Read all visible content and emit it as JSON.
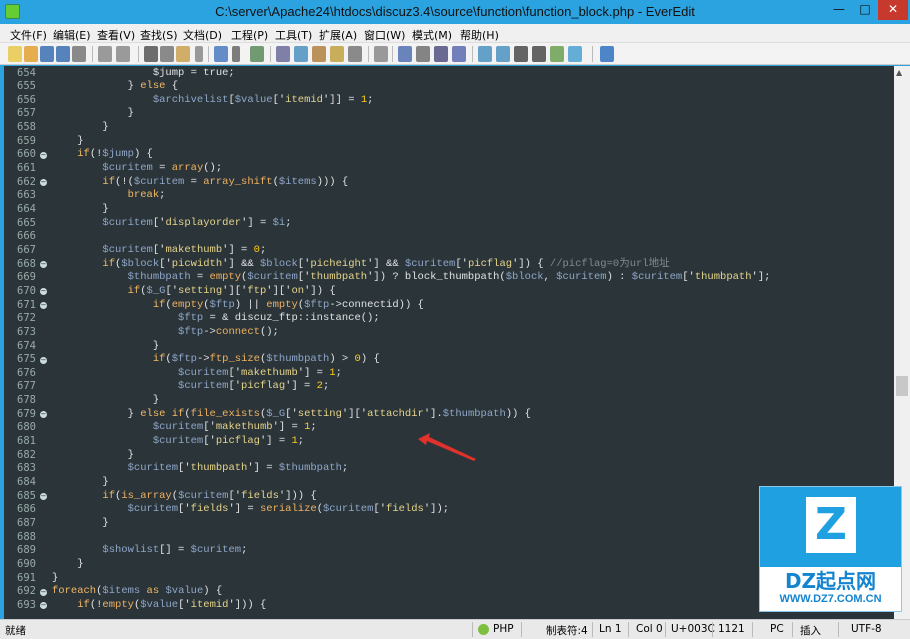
{
  "window": {
    "title": "C:\\server\\Apache24\\htdocs\\discuz3.4\\source\\function\\function_block.php - EverEdit",
    "minimize": "—",
    "maximize": "□",
    "close": "✕"
  },
  "menu": [
    "文件(F)",
    "编辑(E)",
    "查看(V)",
    "查找(S)",
    "文档(D)",
    "工程(P)",
    "工具(T)",
    "扩展(A)",
    "窗口(W)",
    "模式(M)",
    "帮助(H)"
  ],
  "toolbar_icons": [
    "new-file-icon",
    "open-file-icon",
    "save-icon",
    "save-all-icon",
    "print-icon",
    "undo-icon",
    "redo-icon",
    "cut-icon",
    "copy-icon",
    "paste-icon",
    "paste-dropdown-icon",
    "wrap-icon",
    "wrap-dropdown-icon",
    "outline-icon",
    "find-icon",
    "replace-icon",
    "find-in-files-icon",
    "goto-icon",
    "bookmark-icon",
    "column-mode-icon",
    "run-icon",
    "macro-icon",
    "macro-run-icon",
    "macro-record-icon",
    "panel-icon",
    "split-icon",
    "layout-icon",
    "window-icon",
    "browser-icon",
    "refresh-icon",
    "help-icon"
  ],
  "lines": [
    {
      "n": "654",
      "fold": false,
      "tokens": [
        [
          "i",
          "                $jump = true;"
        ]
      ]
    },
    {
      "n": "655",
      "fold": false,
      "tokens": [
        [
          "p",
          "            } "
        ],
        [
          "k",
          "else"
        ],
        [
          "p",
          " {"
        ]
      ]
    },
    {
      "n": "656",
      "fold": false,
      "tokens": [
        [
          "v",
          "                $archivelist"
        ],
        [
          "p",
          "["
        ],
        [
          "v",
          "$value"
        ],
        [
          "p",
          "['"
        ],
        [
          "s",
          "itemid"
        ],
        [
          "p",
          "'"
        ],
        [
          "p",
          "]] = "
        ],
        [
          "n",
          "1"
        ],
        [
          "p",
          ";"
        ]
      ]
    },
    {
      "n": "657",
      "fold": false,
      "tokens": [
        [
          "p",
          "            }"
        ]
      ]
    },
    {
      "n": "658",
      "fold": false,
      "tokens": [
        [
          "p",
          "        }"
        ]
      ]
    },
    {
      "n": "659",
      "fold": false,
      "tokens": [
        [
          "p",
          "    }"
        ]
      ]
    },
    {
      "n": "660",
      "fold": true,
      "tokens": [
        [
          "k",
          "    if"
        ],
        [
          "p",
          "(!"
        ],
        [
          "v",
          "$jump"
        ],
        [
          "p",
          ") {"
        ]
      ]
    },
    {
      "n": "661",
      "fold": false,
      "tokens": [
        [
          "v",
          "        $curitem"
        ],
        [
          "p",
          " = "
        ],
        [
          "f",
          "array"
        ],
        [
          "p",
          "();"
        ]
      ]
    },
    {
      "n": "662",
      "fold": true,
      "tokens": [
        [
          "k",
          "        if"
        ],
        [
          "p",
          "(!("
        ],
        [
          "v",
          "$curitem"
        ],
        [
          "p",
          " = "
        ],
        [
          "f",
          "array_shift"
        ],
        [
          "p",
          "("
        ],
        [
          "v",
          "$items"
        ],
        [
          "p",
          "))) {"
        ]
      ]
    },
    {
      "n": "663",
      "fold": false,
      "tokens": [
        [
          "k",
          "            break"
        ],
        [
          "p",
          ";"
        ]
      ]
    },
    {
      "n": "664",
      "fold": false,
      "tokens": [
        [
          "p",
          "        }"
        ]
      ]
    },
    {
      "n": "665",
      "fold": false,
      "tokens": [
        [
          "v",
          "        $curitem"
        ],
        [
          "p",
          "['"
        ],
        [
          "s",
          "displayorder"
        ],
        [
          "p",
          "'] = "
        ],
        [
          "v",
          "$i"
        ],
        [
          "p",
          ";"
        ]
      ]
    },
    {
      "n": "666",
      "fold": false,
      "tokens": []
    },
    {
      "n": "667",
      "fold": false,
      "tokens": [
        [
          "v",
          "        $curitem"
        ],
        [
          "p",
          "['"
        ],
        [
          "s",
          "makethumb"
        ],
        [
          "p",
          "'] = "
        ],
        [
          "n",
          "0"
        ],
        [
          "p",
          ";"
        ]
      ]
    },
    {
      "n": "668",
      "fold": true,
      "tokens": [
        [
          "k",
          "        if"
        ],
        [
          "p",
          "("
        ],
        [
          "v",
          "$block"
        ],
        [
          "p",
          "['"
        ],
        [
          "s",
          "picwidth"
        ],
        [
          "p",
          "'] && "
        ],
        [
          "v",
          "$block"
        ],
        [
          "p",
          "['"
        ],
        [
          "s",
          "picheight"
        ],
        [
          "p",
          "'] && "
        ],
        [
          "v",
          "$curitem"
        ],
        [
          "p",
          "['"
        ],
        [
          "s",
          "picflag"
        ],
        [
          "p",
          "']) { "
        ],
        [
          "c",
          "//picflag=0为url地址"
        ]
      ]
    },
    {
      "n": "669",
      "fold": false,
      "tokens": [
        [
          "v",
          "            $thumbpath"
        ],
        [
          "p",
          " = "
        ],
        [
          "f",
          "empty"
        ],
        [
          "p",
          "("
        ],
        [
          "v",
          "$curitem"
        ],
        [
          "p",
          "['"
        ],
        [
          "s",
          "thumbpath"
        ],
        [
          "p",
          "']) ? block_thumbpath("
        ],
        [
          "v",
          "$block"
        ],
        [
          "p",
          ", "
        ],
        [
          "v",
          "$curitem"
        ],
        [
          "p",
          ") : "
        ],
        [
          "v",
          "$curitem"
        ],
        [
          "p",
          "['"
        ],
        [
          "s",
          "thumbpath"
        ],
        [
          "p",
          "'];"
        ]
      ]
    },
    {
      "n": "670",
      "fold": true,
      "tokens": [
        [
          "k",
          "            if"
        ],
        [
          "p",
          "("
        ],
        [
          "v",
          "$_G"
        ],
        [
          "p",
          "['"
        ],
        [
          "s",
          "setting"
        ],
        [
          "p",
          "']['"
        ],
        [
          "s",
          "ftp"
        ],
        [
          "p",
          "']['"
        ],
        [
          "s",
          "on"
        ],
        [
          "p",
          "']) {"
        ]
      ]
    },
    {
      "n": "671",
      "fold": true,
      "tokens": [
        [
          "k",
          "                if"
        ],
        [
          "p",
          "("
        ],
        [
          "f",
          "empty"
        ],
        [
          "p",
          "("
        ],
        [
          "v",
          "$ftp"
        ],
        [
          "p",
          ") || "
        ],
        [
          "f",
          "empty"
        ],
        [
          "p",
          "("
        ],
        [
          "v",
          "$ftp"
        ],
        [
          "p",
          "->connectid)) {"
        ]
      ]
    },
    {
      "n": "672",
      "fold": false,
      "tokens": [
        [
          "v",
          "                    $ftp"
        ],
        [
          "p",
          " = & discuz_ftp::instance();"
        ]
      ]
    },
    {
      "n": "673",
      "fold": false,
      "tokens": [
        [
          "v",
          "                    $ftp"
        ],
        [
          "p",
          "->"
        ],
        [
          "f",
          "connect"
        ],
        [
          "p",
          "();"
        ]
      ]
    },
    {
      "n": "674",
      "fold": false,
      "tokens": [
        [
          "p",
          "                }"
        ]
      ]
    },
    {
      "n": "675",
      "fold": true,
      "tokens": [
        [
          "k",
          "                if"
        ],
        [
          "p",
          "("
        ],
        [
          "v",
          "$ftp"
        ],
        [
          "p",
          "->"
        ],
        [
          "f",
          "ftp_size"
        ],
        [
          "p",
          "("
        ],
        [
          "v",
          "$thumbpath"
        ],
        [
          "p",
          ") > "
        ],
        [
          "n",
          "0"
        ],
        [
          "p",
          ") {"
        ]
      ]
    },
    {
      "n": "676",
      "fold": false,
      "tokens": [
        [
          "v",
          "                    $curitem"
        ],
        [
          "p",
          "['"
        ],
        [
          "s",
          "makethumb"
        ],
        [
          "p",
          "'] = "
        ],
        [
          "n",
          "1"
        ],
        [
          "p",
          ";"
        ]
      ]
    },
    {
      "n": "677",
      "fold": false,
      "tokens": [
        [
          "v",
          "                    $curitem"
        ],
        [
          "p",
          "['"
        ],
        [
          "s",
          "picflag"
        ],
        [
          "p",
          "'] = "
        ],
        [
          "n",
          "2"
        ],
        [
          "p",
          ";"
        ]
      ]
    },
    {
      "n": "678",
      "fold": false,
      "tokens": [
        [
          "p",
          "                }"
        ]
      ]
    },
    {
      "n": "679",
      "fold": true,
      "tokens": [
        [
          "p",
          "            } "
        ],
        [
          "k",
          "else if"
        ],
        [
          "p",
          "("
        ],
        [
          "f",
          "file_exists"
        ],
        [
          "p",
          "("
        ],
        [
          "v",
          "$_G"
        ],
        [
          "p",
          "['"
        ],
        [
          "s",
          "setting"
        ],
        [
          "p",
          "']['"
        ],
        [
          "s",
          "attachdir"
        ],
        [
          "p",
          "']."
        ],
        [
          "v",
          "$thumbpath"
        ],
        [
          "p",
          ")) {"
        ]
      ]
    },
    {
      "n": "680",
      "fold": false,
      "tokens": [
        [
          "v",
          "                $curitem"
        ],
        [
          "p",
          "['"
        ],
        [
          "s",
          "makethumb"
        ],
        [
          "p",
          "'] = "
        ],
        [
          "n",
          "1"
        ],
        [
          "p",
          ";"
        ]
      ]
    },
    {
      "n": "681",
      "fold": false,
      "tokens": [
        [
          "v",
          "                $curitem"
        ],
        [
          "p",
          "['"
        ],
        [
          "s",
          "picflag"
        ],
        [
          "p",
          "'] = "
        ],
        [
          "n",
          "1"
        ],
        [
          "p",
          ";"
        ]
      ]
    },
    {
      "n": "682",
      "fold": false,
      "tokens": [
        [
          "p",
          "            }"
        ]
      ]
    },
    {
      "n": "683",
      "fold": false,
      "tokens": [
        [
          "v",
          "            $curitem"
        ],
        [
          "p",
          "['"
        ],
        [
          "s",
          "thumbpath"
        ],
        [
          "p",
          "'] = "
        ],
        [
          "v",
          "$thumbpath"
        ],
        [
          "p",
          ";"
        ]
      ]
    },
    {
      "n": "684",
      "fold": false,
      "tokens": [
        [
          "p",
          "        }"
        ]
      ]
    },
    {
      "n": "685",
      "fold": true,
      "tokens": [
        [
          "k",
          "        if"
        ],
        [
          "p",
          "("
        ],
        [
          "f",
          "is_array"
        ],
        [
          "p",
          "("
        ],
        [
          "v",
          "$curitem"
        ],
        [
          "p",
          "['"
        ],
        [
          "s",
          "fields"
        ],
        [
          "p",
          "'])) {"
        ]
      ]
    },
    {
      "n": "686",
      "fold": false,
      "tokens": [
        [
          "v",
          "            $curitem"
        ],
        [
          "p",
          "['"
        ],
        [
          "s",
          "fields"
        ],
        [
          "p",
          "'] = "
        ],
        [
          "f",
          "serialize"
        ],
        [
          "p",
          "("
        ],
        [
          "v",
          "$curitem"
        ],
        [
          "p",
          "['"
        ],
        [
          "s",
          "fields"
        ],
        [
          "p",
          "']);"
        ]
      ]
    },
    {
      "n": "687",
      "fold": false,
      "tokens": [
        [
          "p",
          "        }"
        ]
      ]
    },
    {
      "n": "688",
      "fold": false,
      "tokens": []
    },
    {
      "n": "689",
      "fold": false,
      "tokens": [
        [
          "v",
          "        $showlist"
        ],
        [
          "p",
          "[] = "
        ],
        [
          "v",
          "$curitem"
        ],
        [
          "p",
          ";"
        ]
      ]
    },
    {
      "n": "690",
      "fold": false,
      "tokens": [
        [
          "p",
          "    }"
        ]
      ]
    },
    {
      "n": "691",
      "fold": false,
      "tokens": [
        [
          "p",
          "}"
        ]
      ]
    },
    {
      "n": "692",
      "fold": true,
      "tokens": [
        [
          "k",
          "foreach"
        ],
        [
          "p",
          "("
        ],
        [
          "v",
          "$items"
        ],
        [
          "p",
          " "
        ],
        [
          "k",
          "as"
        ],
        [
          "p",
          " "
        ],
        [
          "v",
          "$value"
        ],
        [
          "p",
          ") {"
        ]
      ]
    },
    {
      "n": "693",
      "fold": true,
      "tokens": [
        [
          "k",
          "    if"
        ],
        [
          "p",
          "(!"
        ],
        [
          "f",
          "empty"
        ],
        [
          "p",
          "("
        ],
        [
          "v",
          "$value"
        ],
        [
          "p",
          "['"
        ],
        [
          "s",
          "itemid"
        ],
        [
          "p",
          "'])) {"
        ]
      ]
    }
  ],
  "status": {
    "ready": "就绪",
    "lang": "PHP",
    "tab": "制表符:4",
    "line": "Ln 1",
    "col": "Col 0",
    "char": "U+003C",
    "count": "1121",
    "eol": "PC",
    "mode": "插入",
    "encoding": "UTF-8"
  },
  "watermark": {
    "logo": "Z",
    "name": "DZ起点网",
    "url": "WWW.DZ7.COM.CN"
  },
  "colors": {
    "titlebar": "#2aa3e0",
    "editor_bg": "#2b3539",
    "arrow": "#e0322a"
  }
}
